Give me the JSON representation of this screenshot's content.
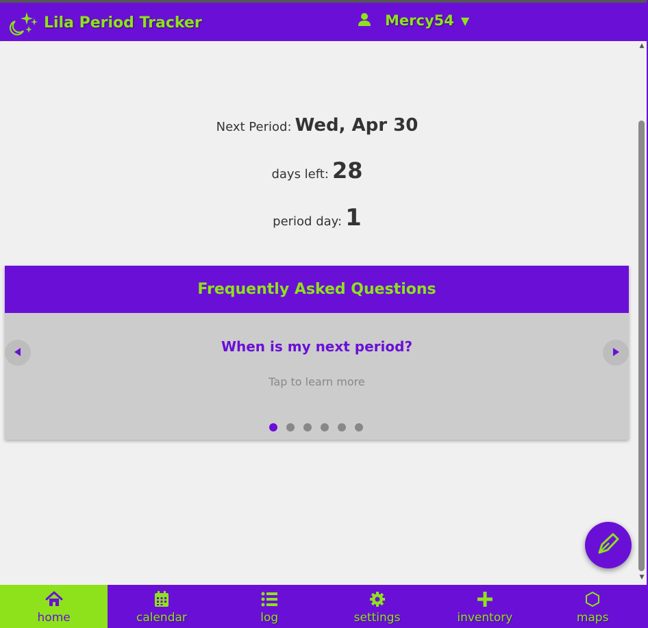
{
  "header": {
    "app_title": "Lila Period Tracker",
    "logo_icon": "moon-stars-icon",
    "user_icon": "user-icon",
    "username": "Mercy54",
    "caret": "▼"
  },
  "stats": {
    "next_period_label": "Next Period:",
    "next_period_value": "Wed, Apr 30",
    "days_left_label": "days left:",
    "days_left_value": "28",
    "period_day_label": "period day:",
    "period_day_value": "1"
  },
  "faq": {
    "title": "Frequently Asked Questions",
    "question": "When is my next period?",
    "hint": "Tap to learn more",
    "slide_count": 6,
    "active_slide": 1
  },
  "nav": {
    "items": [
      {
        "label": "home",
        "icon": "home-icon",
        "active": true
      },
      {
        "label": "calendar",
        "icon": "calendar-icon",
        "active": false
      },
      {
        "label": "log",
        "icon": "list-icon",
        "active": false
      },
      {
        "label": "settings",
        "icon": "gear-icon",
        "active": false
      },
      {
        "label": "inventory",
        "icon": "plus-icon",
        "active": false
      },
      {
        "label": "maps",
        "icon": "hexagon-icon",
        "active": false
      }
    ]
  },
  "fab": {
    "icon": "pen-icon"
  },
  "colors": {
    "primary": "#6a10d6",
    "accent": "#8ee21c",
    "background": "#f0f0f0",
    "carousel": "#cccccc"
  }
}
